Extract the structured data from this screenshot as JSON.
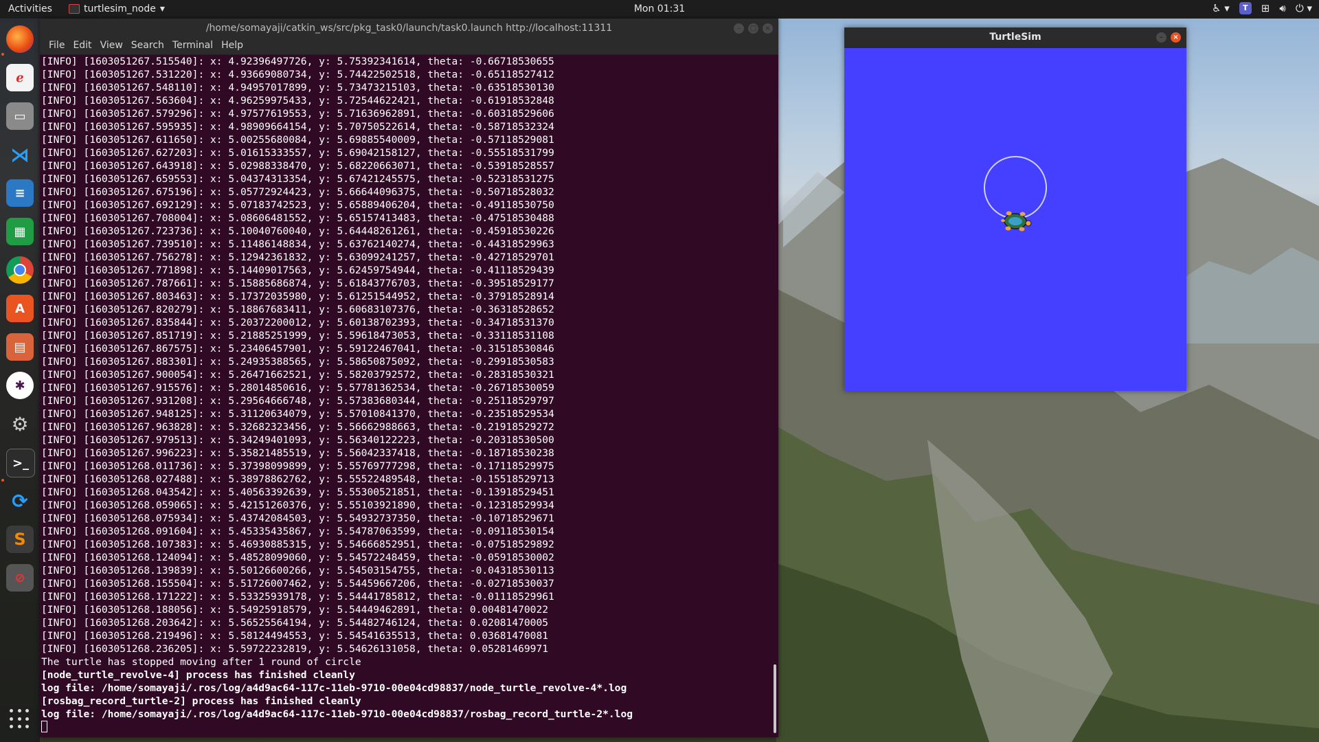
{
  "topbar": {
    "activities": "Activities",
    "app_name": "turtlesim_node",
    "clock": "Mon 01:31"
  },
  "dock": {
    "items": [
      "firefox-icon",
      "evince-icon",
      "files-icon",
      "vscode-icon",
      "writer-icon",
      "calc-icon",
      "chrome-icon",
      "software-center-icon",
      "impress-icon",
      "slack-icon",
      "settings-icon",
      "terminal-icon",
      "update-icon",
      "sublime-icon",
      "blocked-app-icon"
    ]
  },
  "terminal": {
    "title": "/home/somayaji/catkin_ws/src/pkg_task0/launch/task0.launch http://localhost:11311",
    "menu": [
      "File",
      "Edit",
      "View",
      "Search",
      "Terminal",
      "Help"
    ],
    "lines": [
      "[INFO] [1603051267.515540]: x: 4.92396497726, y: 5.75392341614, theta: -0.66718530655",
      "[INFO] [1603051267.531220]: x: 4.93669080734, y: 5.74422502518, theta: -0.65118527412",
      "[INFO] [1603051267.548110]: x: 4.94957017899, y: 5.73473215103, theta: -0.63518530130",
      "[INFO] [1603051267.563604]: x: 4.96259975433, y: 5.72544622421, theta: -0.61918532848",
      "[INFO] [1603051267.579296]: x: 4.97577619553, y: 5.71636962891, theta: -0.60318529606",
      "[INFO] [1603051267.595935]: x: 4.98909664154, y: 5.70750522614, theta: -0.58718532324",
      "[INFO] [1603051267.611650]: x: 5.00255680084, y: 5.69885540009, theta: -0.57118529081",
      "[INFO] [1603051267.627203]: x: 5.01615333557, y: 5.69042158127, theta: -0.55518531799",
      "[INFO] [1603051267.643918]: x: 5.02988338470, y: 5.68220663071, theta: -0.53918528557",
      "[INFO] [1603051267.659553]: x: 5.04374313354, y: 5.67421245575, theta: -0.52318531275",
      "[INFO] [1603051267.675196]: x: 5.05772924423, y: 5.66644096375, theta: -0.50718528032",
      "[INFO] [1603051267.692129]: x: 5.07183742523, y: 5.65889406204, theta: -0.49118530750",
      "[INFO] [1603051267.708004]: x: 5.08606481552, y: 5.65157413483, theta: -0.47518530488",
      "[INFO] [1603051267.723736]: x: 5.10040760040, y: 5.64448261261, theta: -0.45918530226",
      "[INFO] [1603051267.739510]: x: 5.11486148834, y: 5.63762140274, theta: -0.44318529963",
      "[INFO] [1603051267.756278]: x: 5.12942361832, y: 5.63099241257, theta: -0.42718529701",
      "[INFO] [1603051267.771898]: x: 5.14409017563, y: 5.62459754944, theta: -0.41118529439",
      "[INFO] [1603051267.787661]: x: 5.15885686874, y: 5.61843776703, theta: -0.39518529177",
      "[INFO] [1603051267.803463]: x: 5.17372035980, y: 5.61251544952, theta: -0.37918528914",
      "[INFO] [1603051267.820279]: x: 5.18867683411, y: 5.60683107376, theta: -0.36318528652",
      "[INFO] [1603051267.835844]: x: 5.20372200012, y: 5.60138702393, theta: -0.34718531370",
      "[INFO] [1603051267.851719]: x: 5.21885251999, y: 5.59618473053, theta: -0.33118531108",
      "[INFO] [1603051267.867575]: x: 5.23406457901, y: 5.59122467041, theta: -0.31518530846",
      "[INFO] [1603051267.883301]: x: 5.24935388565, y: 5.58650875092, theta: -0.29918530583",
      "[INFO] [1603051267.900054]: x: 5.26471662521, y: 5.58203792572, theta: -0.28318530321",
      "[INFO] [1603051267.915576]: x: 5.28014850616, y: 5.57781362534, theta: -0.26718530059",
      "[INFO] [1603051267.931208]: x: 5.29564666748, y: 5.57383680344, theta: -0.25118529797",
      "[INFO] [1603051267.948125]: x: 5.31120634079, y: 5.57010841370, theta: -0.23518529534",
      "[INFO] [1603051267.963828]: x: 5.32682323456, y: 5.56662988663, theta: -0.21918529272",
      "[INFO] [1603051267.979513]: x: 5.34249401093, y: 5.56340122223, theta: -0.20318530500",
      "[INFO] [1603051267.996223]: x: 5.35821485519, y: 5.56042337418, theta: -0.18718530238",
      "[INFO] [1603051268.011736]: x: 5.37398099899, y: 5.55769777298, theta: -0.17118529975",
      "[INFO] [1603051268.027488]: x: 5.38978862762, y: 5.55522489548, theta: -0.15518529713",
      "[INFO] [1603051268.043542]: x: 5.40563392639, y: 5.55300521851, theta: -0.13918529451",
      "[INFO] [1603051268.059065]: x: 5.42151260376, y: 5.55103921890, theta: -0.12318529934",
      "[INFO] [1603051268.075934]: x: 5.43742084503, y: 5.54932737350, theta: -0.10718529671",
      "[INFO] [1603051268.091604]: x: 5.45335435867, y: 5.54787063599, theta: -0.09118530154",
      "[INFO] [1603051268.107383]: x: 5.46930885315, y: 5.54666852951, theta: -0.07518529892",
      "[INFO] [1603051268.124094]: x: 5.48528099060, y: 5.54572248459, theta: -0.05918530002",
      "[INFO] [1603051268.139839]: x: 5.50126600266, y: 5.54503154755, theta: -0.04318530113",
      "[INFO] [1603051268.155504]: x: 5.51726007462, y: 5.54459667206, theta: -0.02718530037",
      "[INFO] [1603051268.171222]: x: 5.53325939178, y: 5.54441785812, theta: -0.01118529961",
      "[INFO] [1603051268.188056]: x: 5.54925918579, y: 5.54449462891, theta: 0.00481470022",
      "[INFO] [1603051268.203642]: x: 5.56525564194, y: 5.54482746124, theta: 0.02081470005",
      "[INFO] [1603051268.219496]: x: 5.58124494553, y: 5.54541635513, theta: 0.03681470081",
      "[INFO] [1603051268.236205]: x: 5.59722232819, y: 5.54626131058, theta: 0.05281469971",
      "The turtle has stopped moving after 1 round of circle"
    ],
    "bold_lines": [
      "[node_turtle_revolve-4] process has finished cleanly",
      "log file: /home/somayaji/.ros/log/a4d9ac64-117c-11eb-9710-00e04cd98837/node_turtle_revolve-4*.log",
      "[rosbag_record_turtle-2] process has finished cleanly",
      "log file: /home/somayaji/.ros/log/a4d9ac64-117c-11eb-9710-00e04cd98837/rosbag_record_turtle-2*.log"
    ]
  },
  "turtlesim": {
    "title": "TurtleSim",
    "background": "#4540ff"
  }
}
